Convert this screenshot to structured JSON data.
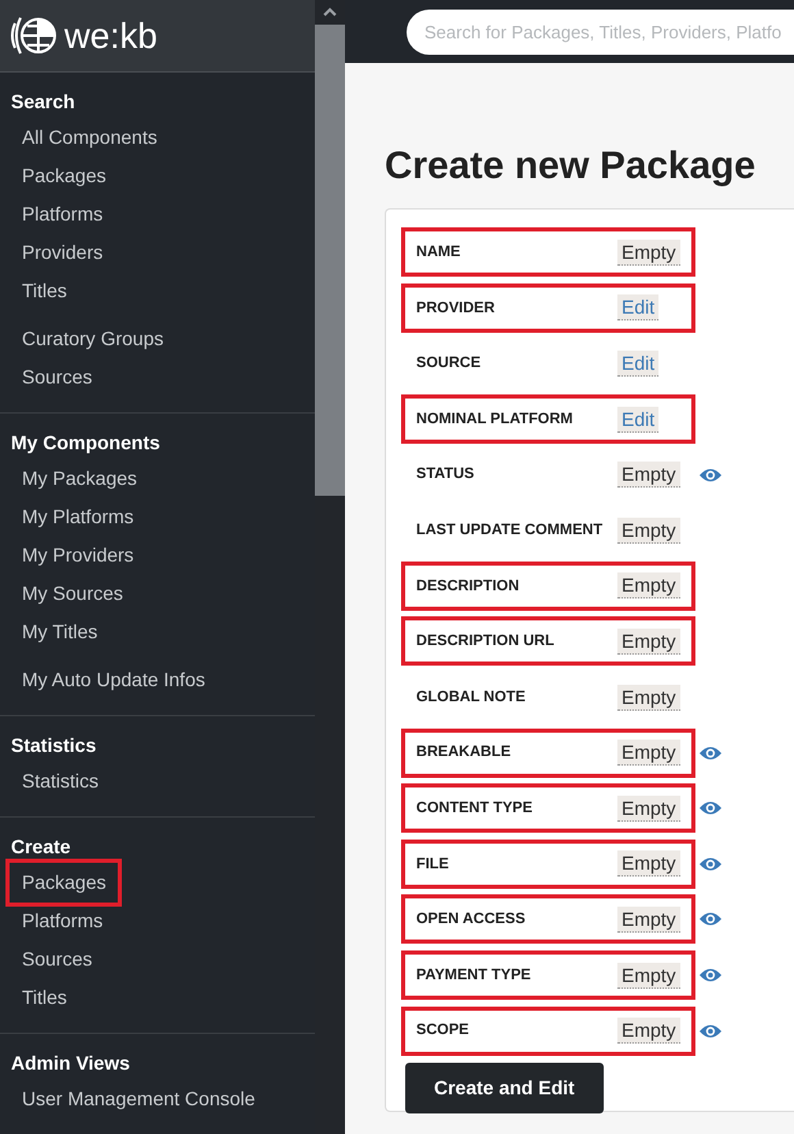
{
  "logo": {
    "text": "we:kb"
  },
  "search": {
    "placeholder": "Search for Packages, Titles, Providers, Platfo"
  },
  "sidebar": {
    "sections": [
      {
        "heading": "Search",
        "groups": [
          [
            {
              "label": "All Components",
              "highlighted": false
            },
            {
              "label": "Packages",
              "highlighted": false
            },
            {
              "label": "Platforms",
              "highlighted": false
            },
            {
              "label": "Providers",
              "highlighted": false
            },
            {
              "label": "Titles",
              "highlighted": false
            }
          ],
          [
            {
              "label": "Curatory Groups",
              "highlighted": false
            },
            {
              "label": "Sources",
              "highlighted": false
            }
          ]
        ]
      },
      {
        "heading": "My Components",
        "groups": [
          [
            {
              "label": "My Packages",
              "highlighted": false
            },
            {
              "label": "My Platforms",
              "highlighted": false
            },
            {
              "label": "My Providers",
              "highlighted": false
            },
            {
              "label": "My Sources",
              "highlighted": false
            },
            {
              "label": "My Titles",
              "highlighted": false
            }
          ],
          [
            {
              "label": "My Auto Update Infos",
              "highlighted": false
            }
          ]
        ]
      },
      {
        "heading": "Statistics",
        "groups": [
          [
            {
              "label": "Statistics",
              "highlighted": false
            }
          ]
        ]
      },
      {
        "heading": "Create",
        "groups": [
          [
            {
              "label": "Packages",
              "highlighted": true
            },
            {
              "label": "Platforms",
              "highlighted": false
            },
            {
              "label": "Sources",
              "highlighted": false
            },
            {
              "label": "Titles",
              "highlighted": false
            }
          ]
        ]
      },
      {
        "heading": "Admin Views",
        "groups": [
          [
            {
              "label": "User Management Console",
              "highlighted": false
            }
          ]
        ]
      }
    ]
  },
  "page": {
    "title": "Create new Package"
  },
  "fields": [
    {
      "label": "NAME",
      "value": "Empty",
      "kind": "empty",
      "eye": false,
      "highlighted": true
    },
    {
      "label": "PROVIDER",
      "value": "Edit",
      "kind": "edit",
      "eye": false,
      "highlighted": true
    },
    {
      "label": "SOURCE",
      "value": "Edit",
      "kind": "edit",
      "eye": false,
      "highlighted": false
    },
    {
      "label": "NOMINAL PLATFORM",
      "value": "Edit",
      "kind": "edit",
      "eye": false,
      "highlighted": true
    },
    {
      "label": "STATUS",
      "value": "Empty",
      "kind": "empty",
      "eye": true,
      "highlighted": false
    },
    {
      "label": "LAST UPDATE COMMENT",
      "value": "Empty",
      "kind": "empty",
      "eye": false,
      "highlighted": false
    },
    {
      "label": "DESCRIPTION",
      "value": "Empty",
      "kind": "empty",
      "eye": false,
      "highlighted": true
    },
    {
      "label": "DESCRIPTION URL",
      "value": "Empty",
      "kind": "empty",
      "eye": false,
      "highlighted": true
    },
    {
      "label": "GLOBAL NOTE",
      "value": "Empty",
      "kind": "empty",
      "eye": false,
      "highlighted": false
    },
    {
      "label": "BREAKABLE",
      "value": "Empty",
      "kind": "empty",
      "eye": true,
      "highlighted": true
    },
    {
      "label": "CONTENT TYPE",
      "value": "Empty",
      "kind": "empty",
      "eye": true,
      "highlighted": true
    },
    {
      "label": "FILE",
      "value": "Empty",
      "kind": "empty",
      "eye": true,
      "highlighted": true
    },
    {
      "label": "OPEN ACCESS",
      "value": "Empty",
      "kind": "empty",
      "eye": true,
      "highlighted": true
    },
    {
      "label": "PAYMENT TYPE",
      "value": "Empty",
      "kind": "empty",
      "eye": true,
      "highlighted": true
    },
    {
      "label": "SCOPE",
      "value": "Empty",
      "kind": "empty",
      "eye": true,
      "highlighted": true
    }
  ],
  "submit": {
    "label": "Create and Edit"
  }
}
